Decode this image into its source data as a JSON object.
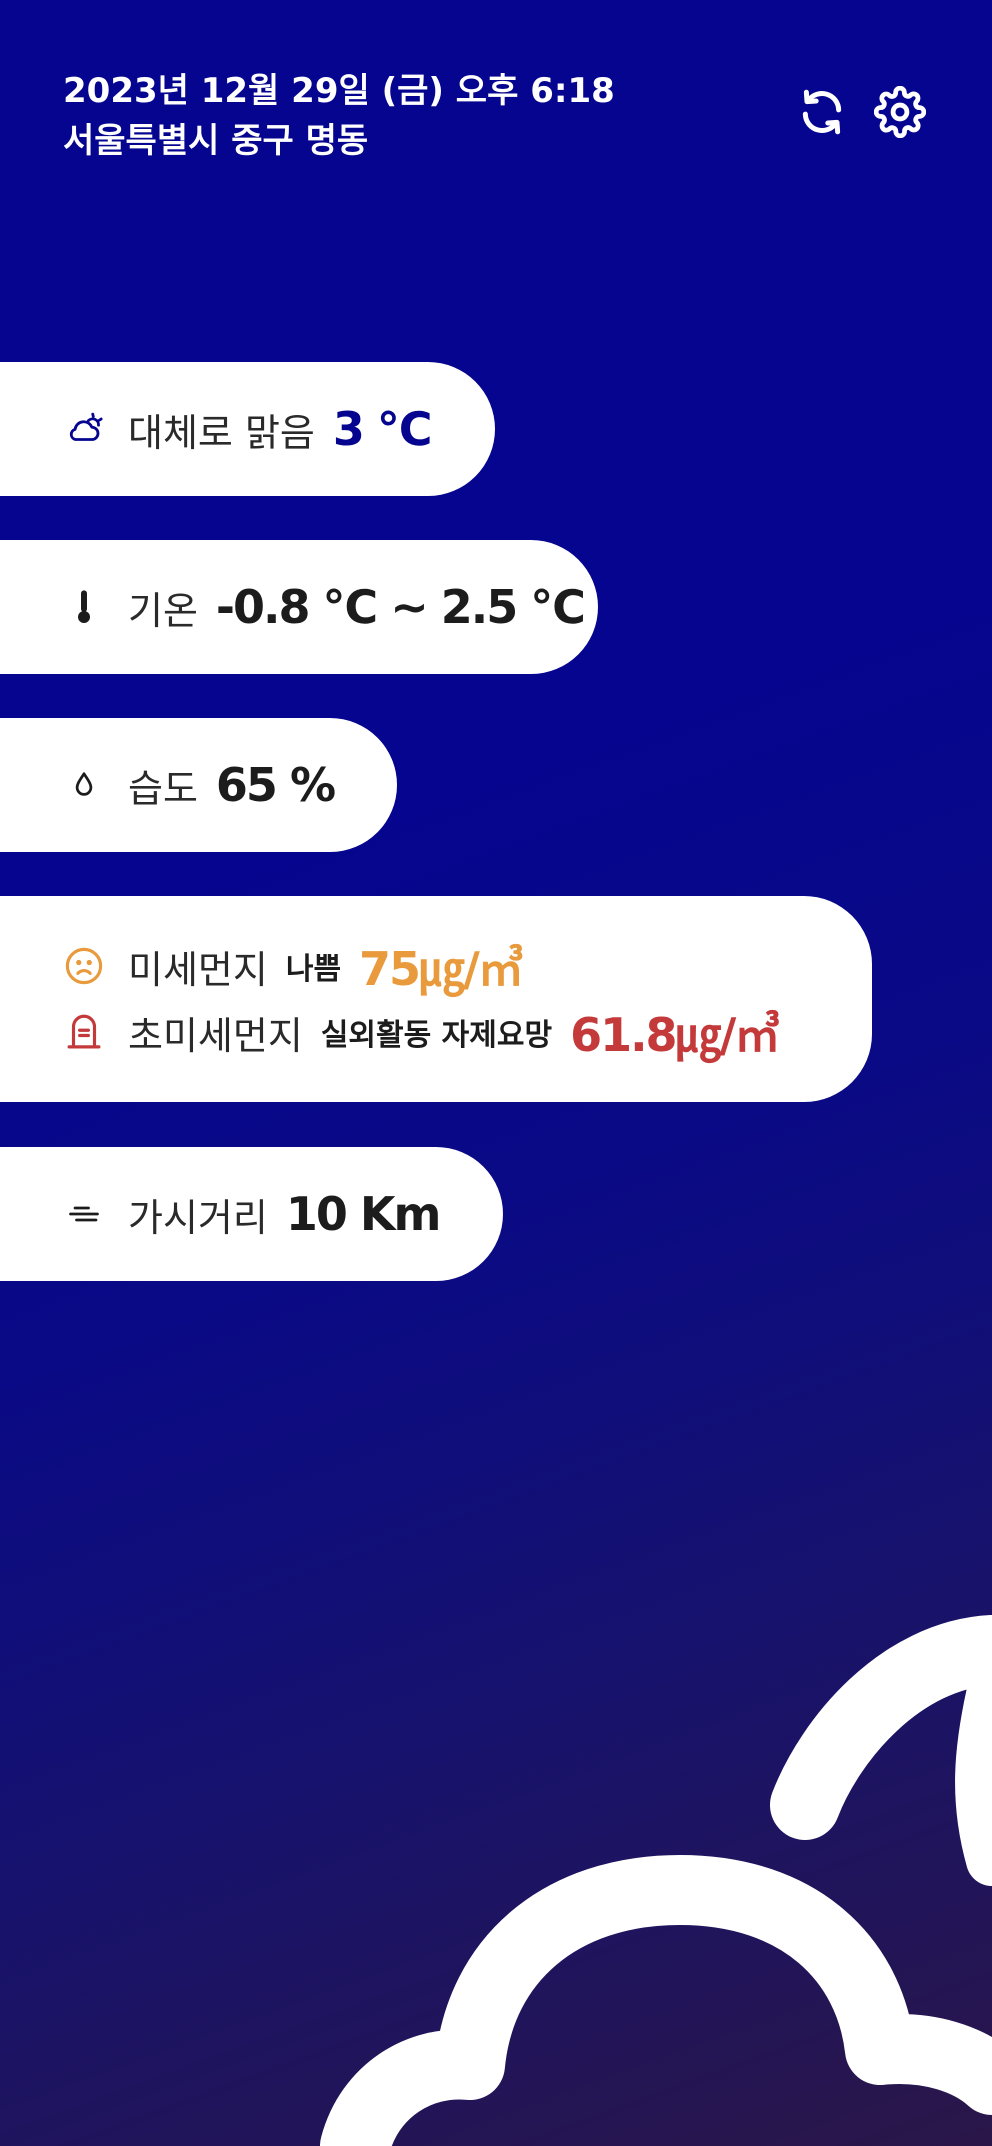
{
  "header": {
    "datetime": "2023년 12월 29일 (금) 오후 6:18",
    "location": "서울특별시 중구 명동"
  },
  "icons": {
    "refresh": "refresh-icon",
    "settings": "gear-icon"
  },
  "condition": {
    "icon": "partly-cloudy-icon",
    "label": "대체로 맑음",
    "temp": "3 ℃"
  },
  "temperature": {
    "icon": "thermometer-icon",
    "label": "기온",
    "range": "-0.8 ℃ ~ 2.5 ℃"
  },
  "humidity": {
    "icon": "droplet-icon",
    "label": "습도",
    "value": "65 %"
  },
  "fine_dust": {
    "icon": "sad-face-icon",
    "label": "미세먼지",
    "status": "나쁨",
    "value": "75㎍/㎥",
    "color": "#e89a3c"
  },
  "ultrafine_dust": {
    "icon": "tombstone-icon",
    "label": "초미세먼지",
    "status": "실외활동 자제요망",
    "value": "61.8㎍/㎥",
    "color": "#c43a3a"
  },
  "visibility": {
    "icon": "wind-lines-icon",
    "label": "가시거리",
    "value": "10 Km"
  },
  "colors": {
    "background": "#05058f",
    "card": "#ffffff",
    "accent_blue": "#05058f"
  }
}
